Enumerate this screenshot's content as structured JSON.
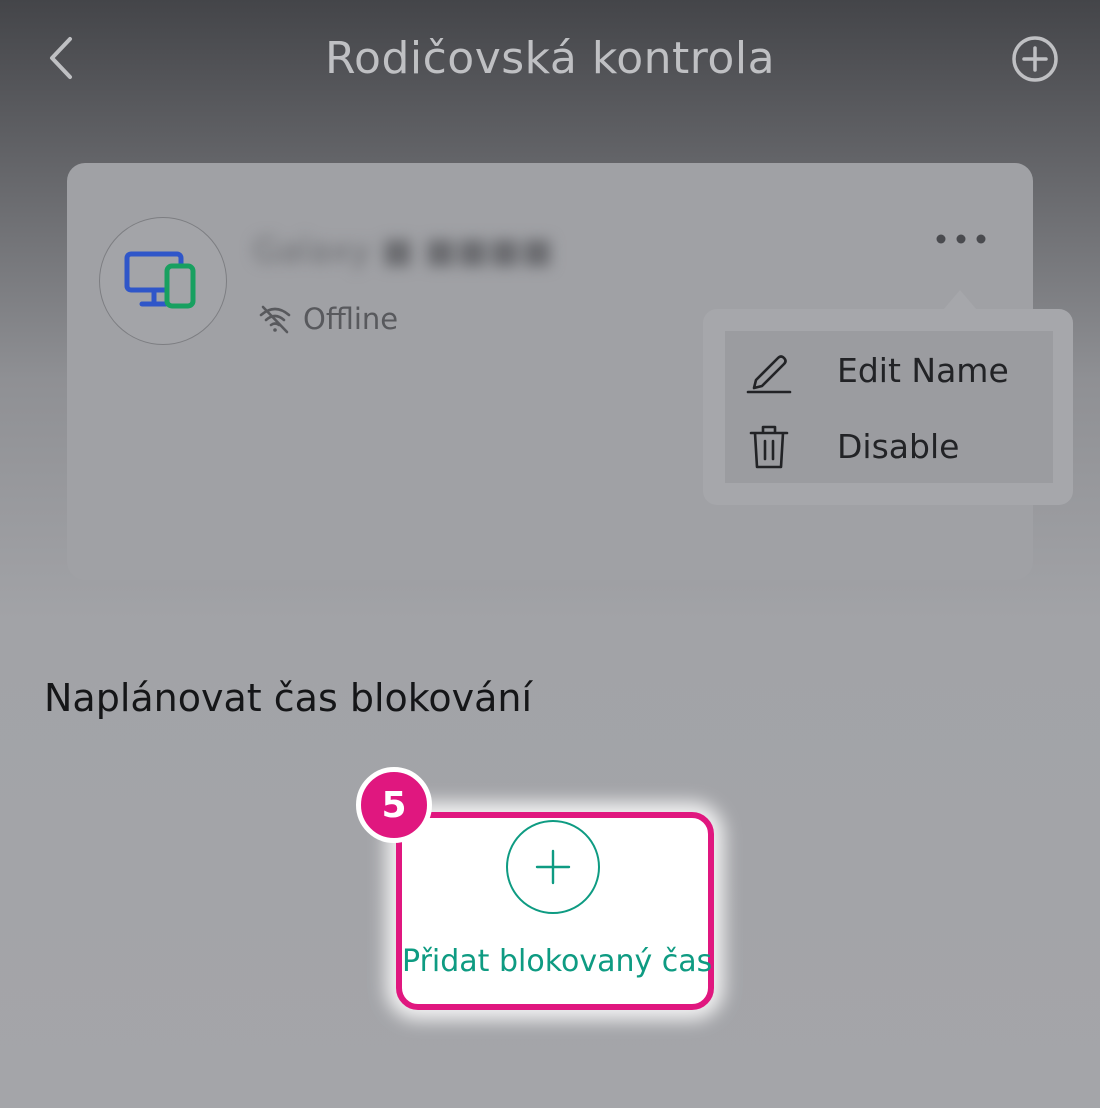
{
  "header": {
    "title": "Rodičovská kontrola",
    "back_icon": "chevron-left-icon",
    "add_icon": "plus-circle-icon"
  },
  "device_card": {
    "name": "Galaxy ■ ■■■■",
    "name_blurred": true,
    "status": "Offline",
    "status_icon": "wifi-off-icon",
    "device_icon": "monitor-and-phone-icon",
    "more_icon": "more-horizontal-icon"
  },
  "context_menu": {
    "items": [
      {
        "label": "Edit Name",
        "icon": "pencil-icon"
      },
      {
        "label": "Disable",
        "icon": "trash-icon"
      }
    ]
  },
  "schedule": {
    "title": "Naplánovat čas blokování",
    "add_tile": {
      "label": "Přidat blokovaný čas",
      "icon": "plus-circle-icon"
    }
  },
  "annotation": {
    "step_badge": "5"
  },
  "colors": {
    "accent_teal": "#0e9b82",
    "highlight_magenta": "#e0177f",
    "device_blue": "#2f56c9",
    "device_green": "#18a060"
  }
}
